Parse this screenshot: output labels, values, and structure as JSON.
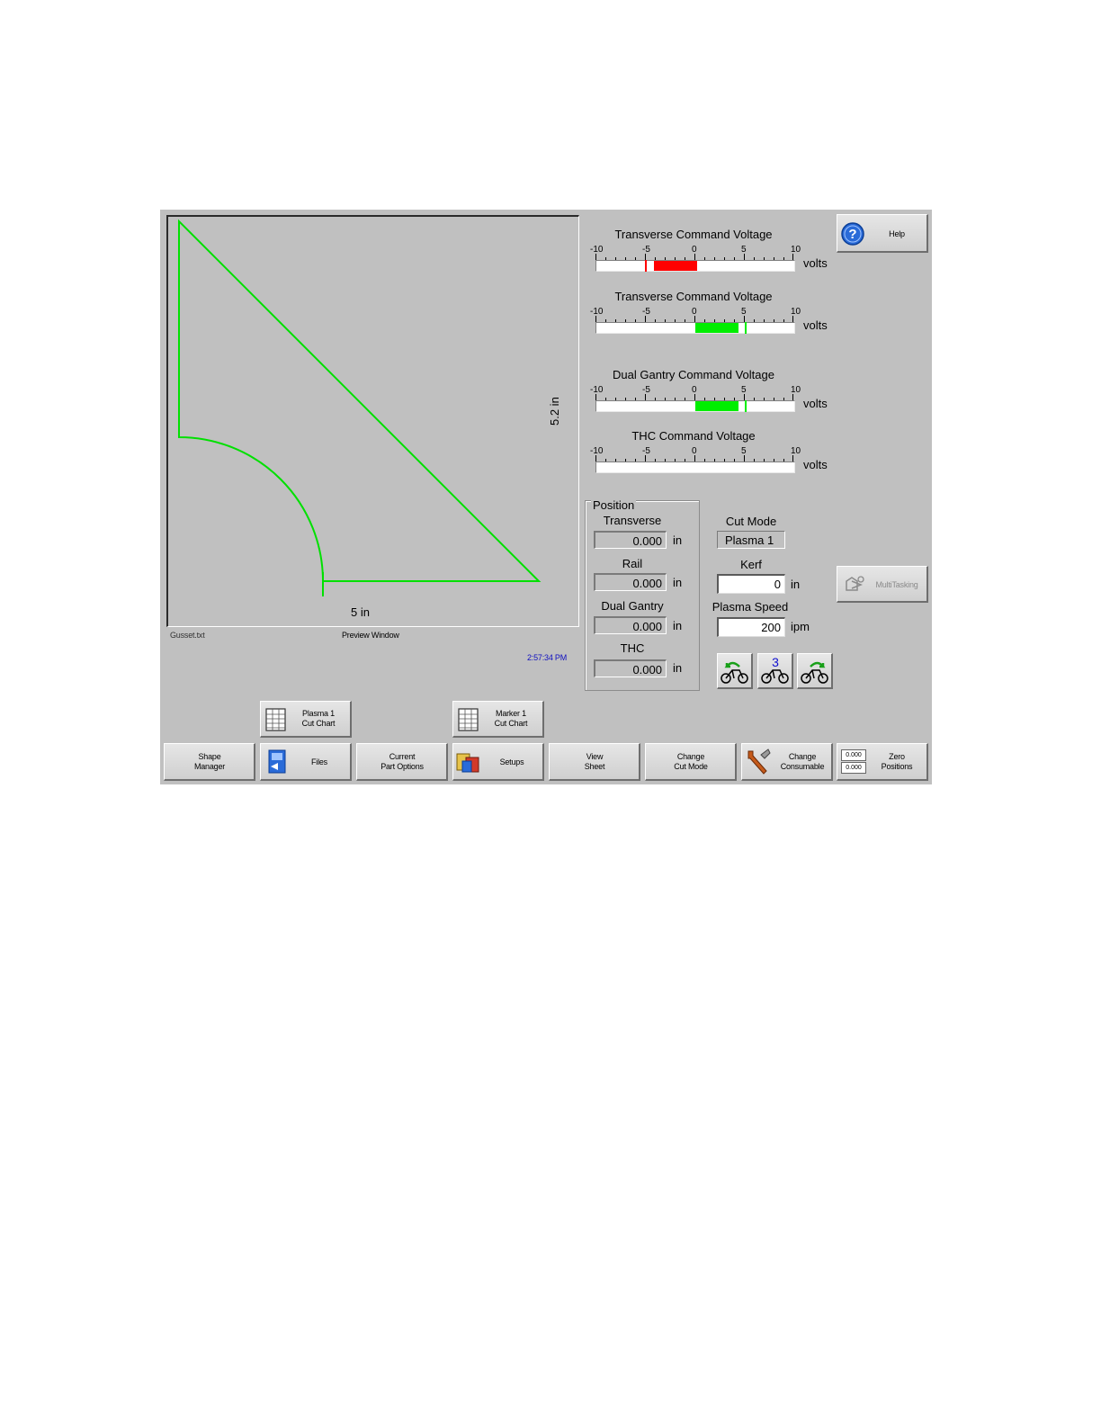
{
  "preview": {
    "width_label": "5 in",
    "height_label": "5.2 in",
    "file_name": "Gusset.txt",
    "window_label": "Preview Window",
    "time": "2:57:34 PM",
    "shape_color": "#00e000"
  },
  "meters": [
    {
      "title": "Transverse Command Voltage",
      "unit": "volts",
      "ticks": [
        "-10",
        "-5",
        "0",
        "5",
        "10"
      ],
      "fill_from": -4.2,
      "fill_to": 0.2,
      "marker": -5,
      "color": "#ff0000"
    },
    {
      "title": "Transverse Command Voltage",
      "unit": "volts",
      "ticks": [
        "-10",
        "-5",
        "0",
        "5",
        "10"
      ],
      "fill_from": 0,
      "fill_to": 4.4,
      "marker": 5.1,
      "color": "#00ee00"
    },
    {
      "title": "Dual Gantry Command Voltage",
      "unit": "volts",
      "ticks": [
        "-10",
        "-5",
        "0",
        "5",
        "10"
      ],
      "fill_from": 0,
      "fill_to": 4.4,
      "marker": 5.1,
      "color": "#00ee00"
    },
    {
      "title": "THC Command Voltage",
      "unit": "volts",
      "ticks": [
        "-10",
        "-5",
        "0",
        "5",
        "10"
      ],
      "fill_from": 0,
      "fill_to": 0,
      "marker": null,
      "color": "#00ee00"
    }
  ],
  "position": {
    "title": "Position",
    "transverse": {
      "label": "Transverse",
      "value": "0.000",
      "unit": "in"
    },
    "rail": {
      "label": "Rail",
      "value": "0.000",
      "unit": "in"
    },
    "dual_gantry": {
      "label": "Dual Gantry",
      "value": "0.000",
      "unit": "in"
    },
    "thc": {
      "label": "THC",
      "value": "0.000",
      "unit": "in"
    }
  },
  "cut": {
    "mode_label": "Cut Mode",
    "mode_value": "Plasma 1",
    "kerf_label": "Kerf",
    "kerf_value": "0",
    "kerf_unit": "in",
    "speed_label": "Plasma Speed",
    "speed_value": "200",
    "speed_unit": "ipm"
  },
  "motion_buttons": {
    "middle_digit": "3"
  },
  "buttons": {
    "help": "Help",
    "multitasking": "MultiTasking",
    "plasma_cut_chart": "Plasma 1\nCut Chart",
    "marker_cut_chart": "Marker 1\nCut Chart",
    "shape_manager": "Shape\nManager",
    "files": "Files",
    "current_part_options": "Current\nPart Options",
    "setups": "Setups",
    "view_sheet": "View\nSheet",
    "change_cut_mode": "Change\nCut Mode",
    "change_consumable": "Change\nConsumable",
    "zero_positions": "Zero\nPositions",
    "zero_icon_value": "0.000"
  }
}
